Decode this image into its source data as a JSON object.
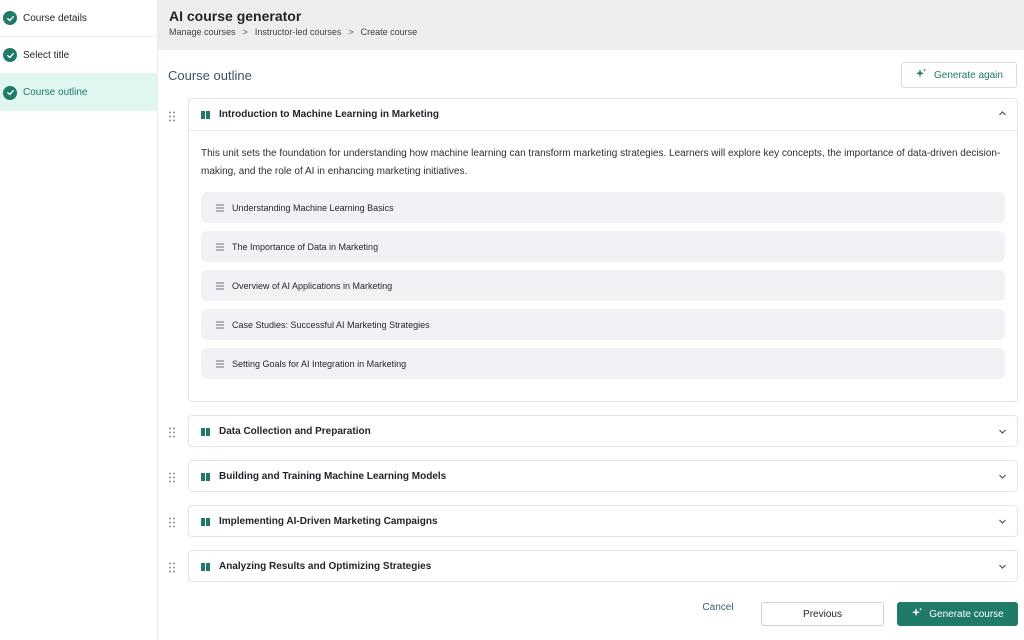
{
  "sidebar": {
    "steps": [
      {
        "label": "Course details",
        "state": "completed"
      },
      {
        "label": "Select title",
        "state": "completed"
      },
      {
        "label": "Course outline",
        "state": "active"
      }
    ]
  },
  "header": {
    "title": "AI course generator",
    "breadcrumb": [
      "Manage courses",
      "Instructor-led courses",
      "Create course"
    ],
    "separator": ">"
  },
  "main": {
    "section_title": "Course outline",
    "generate_again_label": "Generate again",
    "units": [
      {
        "title": "Introduction to Machine Learning in Marketing",
        "expanded": true,
        "description": "This unit sets the foundation for understanding how machine learning can transform marketing strategies. Learners will explore key concepts, the importance of data-driven decision-making, and the role of AI in enhancing marketing initiatives.",
        "lessons": [
          "Understanding Machine Learning Basics",
          "The Importance of Data in Marketing",
          "Overview of AI Applications in Marketing",
          "Case Studies: Successful AI Marketing Strategies",
          "Setting Goals for AI Integration in Marketing"
        ]
      },
      {
        "title": "Data Collection and Preparation",
        "expanded": false
      },
      {
        "title": "Building and Training Machine Learning Models",
        "expanded": false
      },
      {
        "title": "Implementing AI-Driven Marketing Campaigns",
        "expanded": false
      },
      {
        "title": "Analyzing Results and Optimizing Strategies",
        "expanded": false
      }
    ]
  },
  "footer": {
    "cancel_label": "Cancel",
    "previous_label": "Previous",
    "generate_label": "Generate course"
  },
  "icons": {
    "step": "check-circle-icon",
    "unit": "book-icon",
    "lesson": "lesson-lines-icon",
    "drag": "drag-handle-icon",
    "generate": "sparkle-icon"
  },
  "colors": {
    "accent": "#1f7a67",
    "active_step_bg": "#dff6f1",
    "lesson_bg": "#f1f2f6"
  }
}
